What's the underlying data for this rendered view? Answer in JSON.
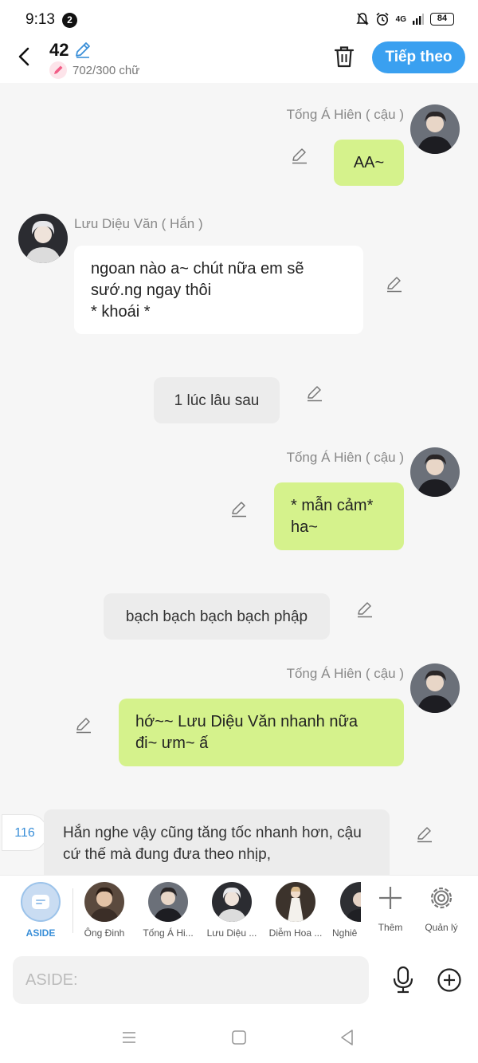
{
  "status_bar": {
    "time": "9:13",
    "notification_count": "2",
    "network": "4G",
    "battery": "84"
  },
  "header": {
    "title": "42",
    "char_count": "702/300 chữ",
    "next_label": "Tiếp theo"
  },
  "messages": [
    {
      "name": "Tống Á Hiên ( cậu )",
      "text": "AA~"
    },
    {
      "name": "Lưu Diệu Văn ( Hắn )",
      "lines": [
        "ngoan nào a~ chút nữa em sẽ",
        "sướ.ng ngay thôi",
        "* khoái *"
      ]
    },
    {
      "text": "1 lúc lâu sau"
    },
    {
      "name": "Tống Á Hiên ( cậu )",
      "lines": [
        "* mẫn cảm*",
        "ha~"
      ]
    },
    {
      "text": "bạch bạch bạch bạch phập"
    },
    {
      "name": "Tống Á Hiên ( cậu )",
      "lines": [
        "hớ~~ Lưu Diệu Văn nhanh nữa",
        "đi~ ưm~ ấ"
      ]
    },
    {
      "lines": [
        "Hắn nghe vậy cũng tăng tốc nhanh hơn, cậu",
        "cứ thế mà đung đưa theo nhịp,"
      ]
    }
  ],
  "scroll_badge": "116",
  "characters": [
    {
      "label": "ASIDE"
    },
    {
      "label": "Ông Đinh"
    },
    {
      "label": "Tống Á Hi..."
    },
    {
      "label": "Lưu Diệu ..."
    },
    {
      "label": "Diễm Hoa ..."
    },
    {
      "label": "Nghiê"
    }
  ],
  "tools": {
    "add_label": "Thêm",
    "manage_label": "Quản lý"
  },
  "input": {
    "placeholder": "ASIDE:"
  },
  "colors": {
    "accent": "#3aa0f0",
    "bubble_green": "#d5f28c",
    "narration_gray": "#ececec"
  }
}
